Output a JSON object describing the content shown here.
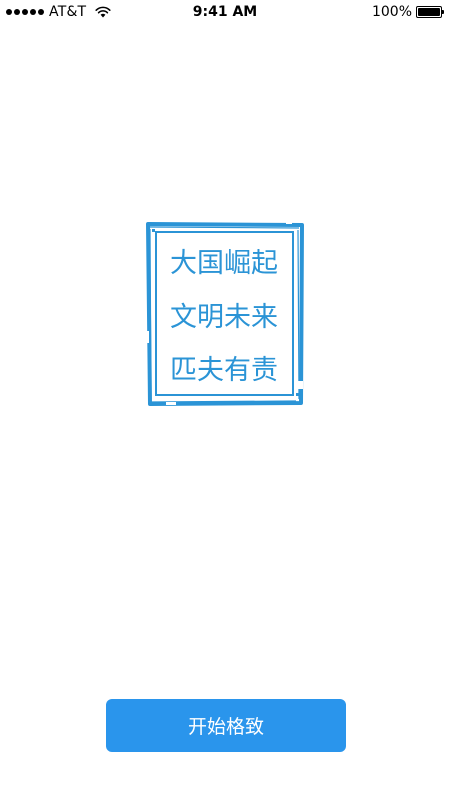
{
  "status_bar": {
    "carrier": "AT&T",
    "time": "9:41 AM",
    "battery_percent": "100%",
    "signal_bars": 5,
    "battery_level": 1.0,
    "icons": [
      "signal-icon",
      "wifi-icon",
      "battery-icon"
    ]
  },
  "seal": {
    "lines": [
      "大国崛起",
      "文明未来",
      "匹夫有责"
    ],
    "color": "#2b94d6"
  },
  "start_button": {
    "label": "开始格致",
    "color": "#2a95ec"
  }
}
